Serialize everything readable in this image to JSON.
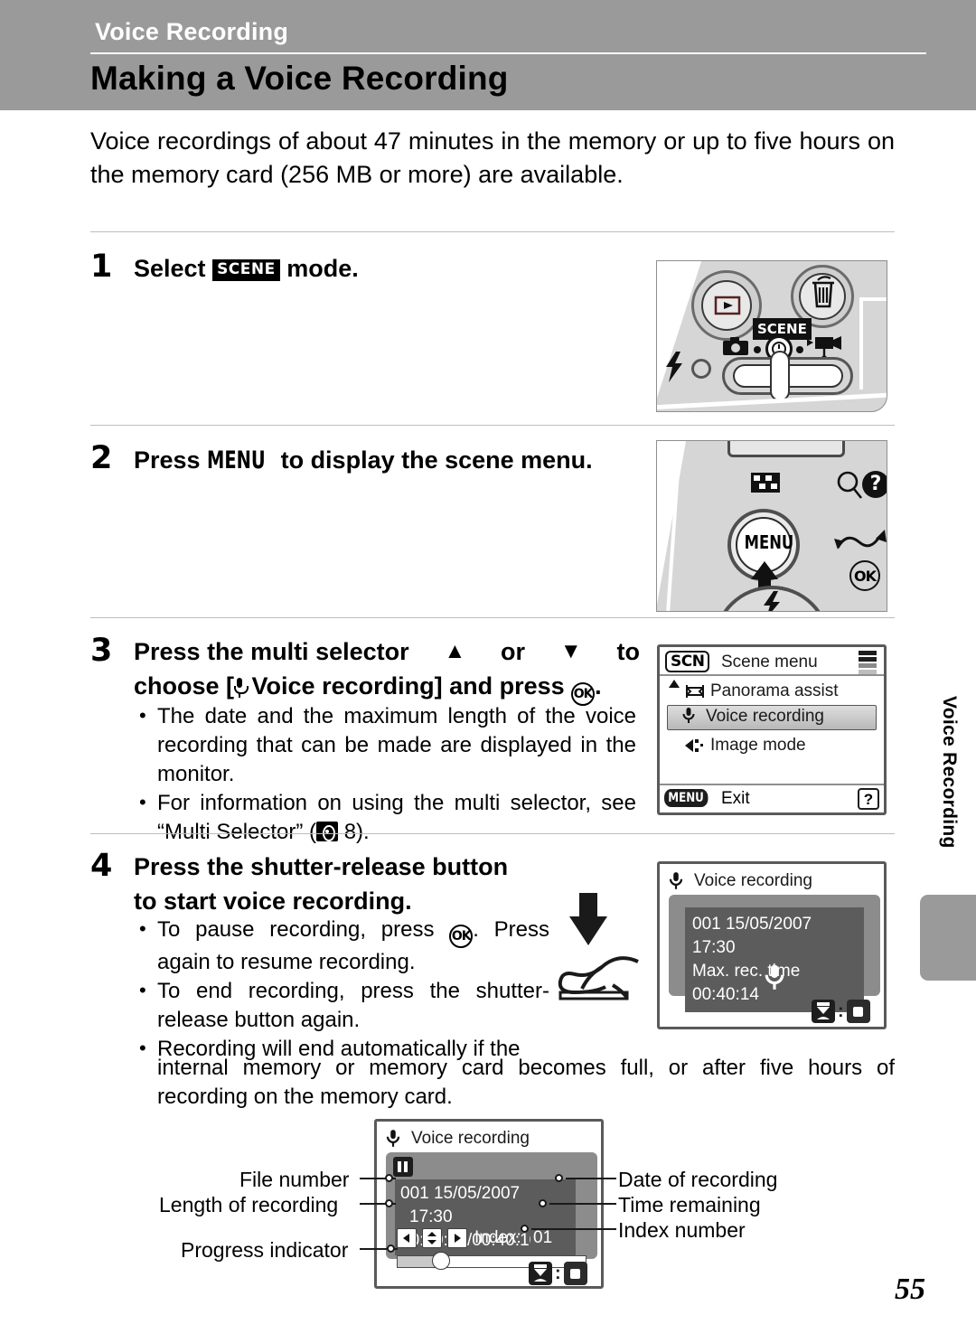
{
  "header": {
    "kicker": "Voice Recording",
    "title": "Making a Voice Recording"
  },
  "intro": "Voice recordings of about 47 minutes in the memory or up to five hours on the memory card (256 MB or more) are available.",
  "steps": [
    {
      "number": "1",
      "head_pre": "Select ",
      "head_icon": "SCENE",
      "head_post": " mode."
    },
    {
      "number": "2",
      "head_pre": "Press ",
      "head_icon": "MENU",
      "head_post": " to display the scene menu."
    },
    {
      "number": "3",
      "head_line1_pre": "Press the multi selector ",
      "head_up": "▲",
      "head_or": " or ",
      "head_down": "▼",
      "head_line1_post": " to",
      "head_line2_pre": "choose [",
      "head_line2_mid": " Voice recording] and press ",
      "head_ok": "OK",
      "head_line2_post": ".",
      "bullets": [
        "The date and the maximum length of the voice recording that can be made are displayed in the monitor.",
        "For information on using the multi selector, see “Multi Selector” (",
        " 8)."
      ]
    },
    {
      "number": "4",
      "head_line1": "Press the shutter-release button",
      "head_line2": "to start voice recording.",
      "bullets": [
        "To pause recording, press ",
        ". Press again to resume recording.",
        "To end recording, press the shutter-release button again.",
        "Recording will end automatically if the",
        "internal memory or memory card becomes full, or after five hours of recording on the memory card."
      ]
    }
  ],
  "scene_menu": {
    "mode_badge": "SCN",
    "title": "Scene menu",
    "items": [
      {
        "label": "Panorama assist",
        "icon": "panorama-icon",
        "selected": false
      },
      {
        "label": "Voice recording",
        "icon": "microphone-icon",
        "selected": true
      },
      {
        "label": "Image mode",
        "icon": "image-mode-icon",
        "selected": false
      }
    ],
    "footer_tag": "MENU",
    "footer_label": "Exit",
    "help_label": "?"
  },
  "voice_screen": {
    "title": "Voice recording",
    "line1": "001 15/05/2007   17:30",
    "line2": "Max. rec. time  00:40:14"
  },
  "diagram": {
    "screen": {
      "title": "Voice recording",
      "line1_file": "001",
      "line1_date": "15/05/2007",
      "line1_time": "17:30",
      "line2": "00:00:04/00:40:10",
      "index_label": "Index:",
      "index_value": "01",
      "arrow_left": "◀",
      "arrow_updown": "▲▼",
      "arrow_right": "▶",
      "progress_percent": 26
    },
    "callouts_left": [
      "File number",
      "Length of recording",
      "Progress indicator"
    ],
    "callouts_right": [
      "Date of recording",
      "Time remaining",
      "Index number"
    ]
  },
  "camera_top": {
    "scene_label": "SCENE",
    "playback_icon": "playback-icon",
    "delete_icon": "trash-icon",
    "flash_icon": "flash-icon",
    "camera_icon": "camera-icon",
    "movie_icon": "movie-icon"
  },
  "camera_menu": {
    "menu_label": "MENU",
    "ok_label": "OK",
    "help_label": "?",
    "thumbnail_icon": "thumbnail-grid-icon",
    "zoom_icon": "magnifier-icon",
    "flash_icon": "flash-icon"
  },
  "side_tab": "Voice Recording",
  "page_number": "55",
  "colors": {
    "header_bg": "#9a9a9a",
    "screen_border": "#5a5a5a",
    "screen_body": "#8c8c8c",
    "info_bg": "#5c5c5c"
  }
}
